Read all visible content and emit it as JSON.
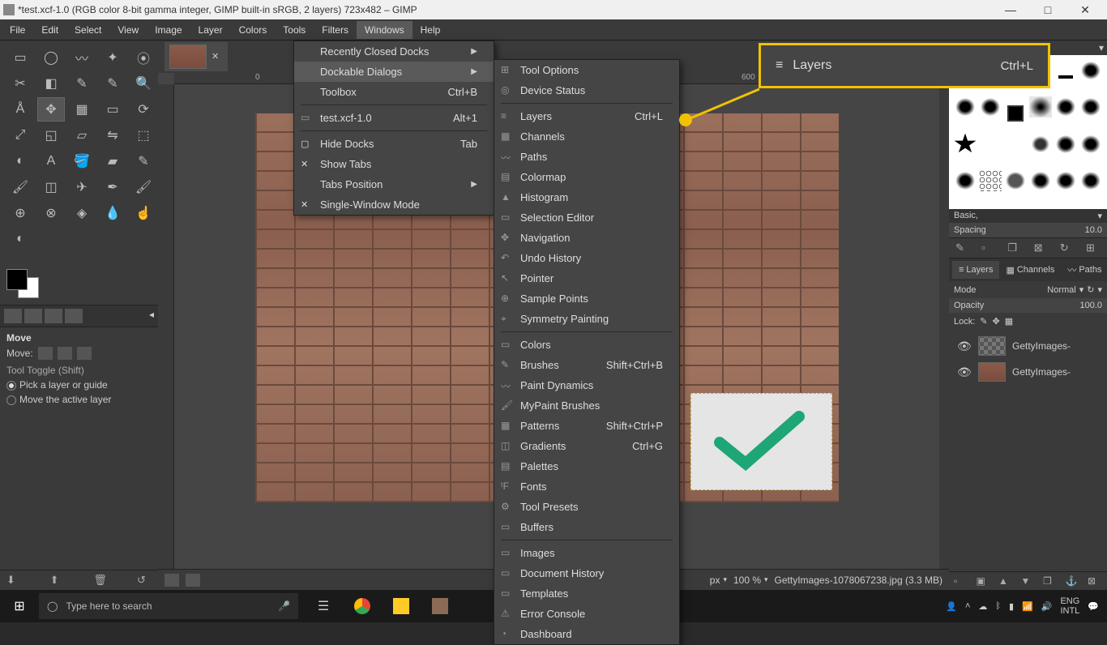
{
  "titlebar": {
    "app": "GIMP",
    "title": "*test.xcf-1.0 (RGB color 8-bit gamma integer, GIMP built-in sRGB, 2 layers) 723x482 – GIMP"
  },
  "window_controls": {
    "minimize": "—",
    "maximize": "□",
    "close": "✕"
  },
  "menubar": [
    "File",
    "Edit",
    "Select",
    "View",
    "Image",
    "Layer",
    "Colors",
    "Tools",
    "Filters",
    "Windows",
    "Help"
  ],
  "active_menu": "Windows",
  "windows_menu": [
    {
      "label": "Recently Closed Docks",
      "arrow": true
    },
    {
      "label": "Dockable Dialogs",
      "arrow": true,
      "highlight": true
    },
    {
      "label": "Toolbox",
      "shortcut": "Ctrl+B"
    },
    {
      "sep": true
    },
    {
      "label": "test.xcf-1.0",
      "shortcut": "Alt+1",
      "icon": "img"
    },
    {
      "sep": true
    },
    {
      "label": "Hide Docks",
      "shortcut": "Tab",
      "check": ""
    },
    {
      "label": "Show Tabs",
      "check": "✕"
    },
    {
      "label": "Tabs Position",
      "arrow": true
    },
    {
      "label": "Single-Window Mode",
      "check": "✕"
    }
  ],
  "dockable_menu": [
    {
      "label": "Tool Options",
      "icon": "⊞"
    },
    {
      "label": "Device Status",
      "icon": "◎"
    },
    {
      "sep": true
    },
    {
      "label": "Layers",
      "shortcut": "Ctrl+L",
      "icon": "≡"
    },
    {
      "label": "Channels",
      "icon": "▦"
    },
    {
      "label": "Paths",
      "icon": "〰"
    },
    {
      "label": "Colormap",
      "icon": "▤"
    },
    {
      "label": "Histogram",
      "icon": "▲"
    },
    {
      "label": "Selection Editor",
      "icon": "▭"
    },
    {
      "label": "Navigation",
      "icon": "✥"
    },
    {
      "label": "Undo History",
      "icon": "↶"
    },
    {
      "label": "Pointer",
      "icon": "↖"
    },
    {
      "label": "Sample Points",
      "icon": "⊕"
    },
    {
      "label": "Symmetry Painting",
      "icon": "⌖"
    },
    {
      "sep": true
    },
    {
      "label": "Colors",
      "icon": "▭"
    },
    {
      "label": "Brushes",
      "shortcut": "Shift+Ctrl+B",
      "icon": "✎"
    },
    {
      "label": "Paint Dynamics",
      "icon": "〰"
    },
    {
      "label": "MyPaint Brushes",
      "icon": "🖌"
    },
    {
      "label": "Patterns",
      "shortcut": "Shift+Ctrl+P",
      "icon": "▦"
    },
    {
      "label": "Gradients",
      "shortcut": "Ctrl+G",
      "icon": "◫"
    },
    {
      "label": "Palettes",
      "icon": "▤"
    },
    {
      "label": "Fonts",
      "icon": "ᵗF"
    },
    {
      "label": "Tool Presets",
      "icon": "⚙"
    },
    {
      "label": "Buffers",
      "icon": "▭"
    },
    {
      "sep": true
    },
    {
      "label": "Images",
      "icon": "▭"
    },
    {
      "label": "Document History",
      "icon": "▭"
    },
    {
      "label": "Templates",
      "icon": "▭"
    },
    {
      "label": "Error Console",
      "icon": "⚠"
    },
    {
      "label": "Dashboard",
      "icon": "◔"
    }
  ],
  "callout": {
    "icon": "≡",
    "label": "Layers",
    "shortcut": "Ctrl+L"
  },
  "tooloptions": {
    "title": "Move",
    "move_label": "Move:",
    "toggle_title": "Tool Toggle  (Shift)",
    "opt1": "Pick a layer or guide",
    "opt2": "Move the active layer"
  },
  "brushpanel": {
    "preset": "Basic,",
    "spacing_label": "Spacing",
    "spacing_value": "10.0"
  },
  "layerpanel": {
    "tabs": [
      "Layers",
      "Channels",
      "Paths"
    ],
    "mode_label": "Mode",
    "mode_value": "Normal",
    "opacity_label": "Opacity",
    "opacity_value": "100.0",
    "lock_label": "Lock:",
    "layers": [
      {
        "name": "GettyImages-"
      },
      {
        "name": "GettyImages-"
      }
    ]
  },
  "statusbar": {
    "unit": "px",
    "unit_arrow": "▾",
    "zoom": "100 %",
    "zoom_arrow": "▾",
    "filename": "GettyImages-1078067238.jpg (3.3 MB)"
  },
  "ruler": {
    "mark1": "0",
    "mark2": "600"
  },
  "taskbar": {
    "search_placeholder": "Type here to search",
    "lang": "ENG",
    "kbd": "INTL"
  }
}
